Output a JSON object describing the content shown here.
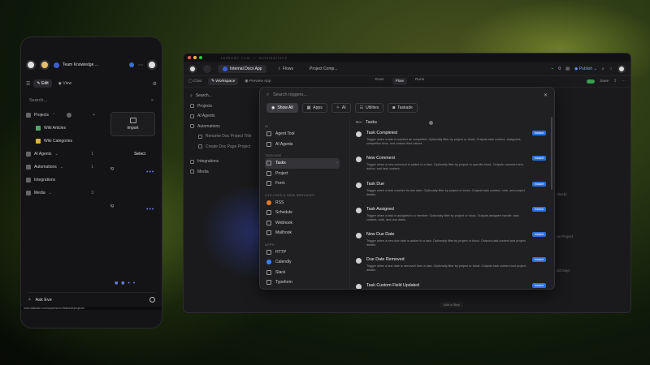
{
  "colors": {
    "accent": "#2f6fe0",
    "toggle_on": "#3a9d4f",
    "background": "#1a1a1c"
  },
  "phone": {
    "workspace": "Team Knowledge ...",
    "tabs": [
      "Edit",
      "View"
    ],
    "search_placeholder": "Search...",
    "import_label": "Import",
    "select_label": "Select",
    "ask_label": "Ask Eve",
    "status_url": "www.taskade.com/spaces/xxx/taskade/projects",
    "items": [
      {
        "label": "Projects",
        "count": "",
        "icon": "folder-icon"
      },
      {
        "label": "Wiki Articles",
        "count": "",
        "icon": "wiki-icon"
      },
      {
        "label": "Wiki Categories",
        "count": "",
        "icon": "category-icon"
      },
      {
        "label": "AI Agents",
        "count": "1",
        "icon": "agent-icon"
      },
      {
        "label": "Automations",
        "count": "1",
        "icon": "automation-icon"
      },
      {
        "label": "Integrations",
        "count": "",
        "icon": "integration-icon"
      },
      {
        "label": "Media",
        "count": "3",
        "icon": "media-icon"
      }
    ],
    "side_fragments": [
      "ig",
      "ig"
    ]
  },
  "desktop": {
    "titlebar": "taskade.com — automations",
    "tabs": [
      {
        "label": "Internal Docs App",
        "active": true
      },
      {
        "label": "Flows",
        "active": false
      },
      {
        "label": "Project Comp...",
        "active": false
      }
    ],
    "counter": "0",
    "publish_label": "Publish",
    "subtabs": [
      {
        "label": "Chat",
        "active": false
      },
      {
        "label": "Workspace",
        "active": true
      },
      {
        "label": "Preview App",
        "active": false
      }
    ],
    "center_tabs": [
      {
        "label": "Runs",
        "active": false
      },
      {
        "label": "Flow",
        "active": true
      },
      {
        "label": "Runs",
        "active": false
      }
    ],
    "save_label": "Save",
    "sidebar": {
      "search_placeholder": "Search...",
      "items": [
        {
          "label": "Projects",
          "sub": false
        },
        {
          "label": "AI Agents",
          "sub": false
        },
        {
          "label": "Automations",
          "sub": false
        },
        {
          "label": "Rename Doc Project Title",
          "sub": true
        },
        {
          "label": "Create Doc Page Project",
          "sub": true
        },
        {
          "label": "Integrations",
          "sub": false
        },
        {
          "label": "Media",
          "sub": false
        }
      ]
    },
    "canvas_notes": [
      "Slack)",
      "ue Project",
      "dd Days"
    ],
    "add_step_label": "Add a Step"
  },
  "modal": {
    "search_placeholder": "Search triggers...",
    "filters": [
      {
        "label": "Show All",
        "active": true
      },
      {
        "label": "Apps",
        "active": false
      },
      {
        "label": "AI",
        "active": false
      },
      {
        "label": "Utilities",
        "active": false
      },
      {
        "label": "Taskade",
        "active": false
      }
    ],
    "sections": [
      {
        "heading": "AI",
        "rows": [
          {
            "label": "Agent Tool",
            "icon": "agent-tool-icon",
            "sel": false
          },
          {
            "label": "AI Agents",
            "icon": "ai-agents-icon",
            "sel": false
          }
        ]
      },
      {
        "heading": "TASKADE",
        "rows": [
          {
            "label": "Tasks",
            "icon": "tasks-icon",
            "sel": true
          },
          {
            "label": "Project",
            "icon": "project-icon",
            "sel": false
          },
          {
            "label": "Form",
            "icon": "form-icon",
            "sel": false
          }
        ]
      },
      {
        "heading": "UTILITIES & WEB SERVICES",
        "rows": [
          {
            "label": "RSS",
            "icon": "rss-icon",
            "sel": false
          },
          {
            "label": "Schedule",
            "icon": "schedule-icon",
            "sel": false
          },
          {
            "label": "Webhook",
            "icon": "webhook-icon",
            "sel": false
          },
          {
            "label": "Mailhook",
            "icon": "mailhook-icon",
            "sel": false
          }
        ]
      },
      {
        "heading": "APPS",
        "rows": [
          {
            "label": "HTTP",
            "icon": "http-icon",
            "sel": false
          },
          {
            "label": "Calendly",
            "icon": "calendly-icon",
            "sel": false
          },
          {
            "label": "Slack",
            "icon": "slack-icon",
            "sel": false
          },
          {
            "label": "Typeform",
            "icon": "typeform-icon",
            "sel": false
          }
        ]
      }
    ],
    "back_label": "Tasks",
    "triggers": [
      {
        "title": "Task Completed",
        "badge": "Instant",
        "desc": "Trigger when a task is marked as completed. Optionally filter by project or block. Outputs task content, assignees, completion time, and custom field values."
      },
      {
        "title": "New Comment",
        "badge": "Instant",
        "desc": "Trigger when a new comment is added to a task. Optionally filter by project or specific block. Outputs comment text, author, and task content."
      },
      {
        "title": "Task Due",
        "badge": "Instant",
        "desc": "Trigger when a task reaches its due date. Optionally filter by project or block. Outputs task content, note, and project details."
      },
      {
        "title": "Task Assigned",
        "badge": "Instant",
        "desc": "Trigger when a task is assigned to a member. Optionally filter by project or block. Outputs assignee handle, task content, note, and due dates."
      },
      {
        "title": "New Due Date",
        "badge": "Instant",
        "desc": "Trigger when a new due date is added to a task. Optionally filter by project or block. Outputs task content and project details."
      },
      {
        "title": "Due Date Removed",
        "badge": "Instant",
        "desc": "Trigger when a due date is removed from a task. Optionally filter by project or block. Outputs task content and project details."
      },
      {
        "title": "Task Custom Field Updated",
        "badge": "Instant",
        "desc": ""
      }
    ]
  }
}
